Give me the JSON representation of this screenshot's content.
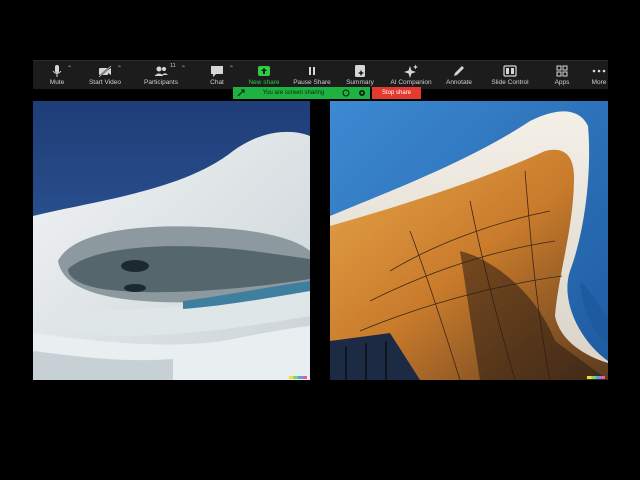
{
  "toolbar": {
    "items": [
      {
        "label": "Mute",
        "icon": "microphone-icon"
      },
      {
        "label": "Start Video",
        "icon": "video-off-icon"
      },
      {
        "label": "Participants",
        "icon": "participants-icon",
        "count": "11"
      },
      {
        "label": "Chat",
        "icon": "chat-icon"
      },
      {
        "label": "New share",
        "icon": "share-screen-icon"
      },
      {
        "label": "Pause Share",
        "icon": "pause-icon"
      },
      {
        "label": "Summary",
        "icon": "summary-icon"
      },
      {
        "label": "AI Companion",
        "icon": "sparkle-icon"
      },
      {
        "label": "Annotate",
        "icon": "pencil-icon"
      },
      {
        "label": "Slide Control",
        "icon": "slide-control-icon"
      },
      {
        "label": "Apps",
        "icon": "apps-icon"
      },
      {
        "label": "More",
        "icon": "more-icon"
      }
    ],
    "accent_color": "#2ecc40"
  },
  "banner": {
    "message": "You are screen sharing",
    "stop_label": "Stop share",
    "banner_color": "#1fb141",
    "stop_color": "#e23a2f"
  }
}
